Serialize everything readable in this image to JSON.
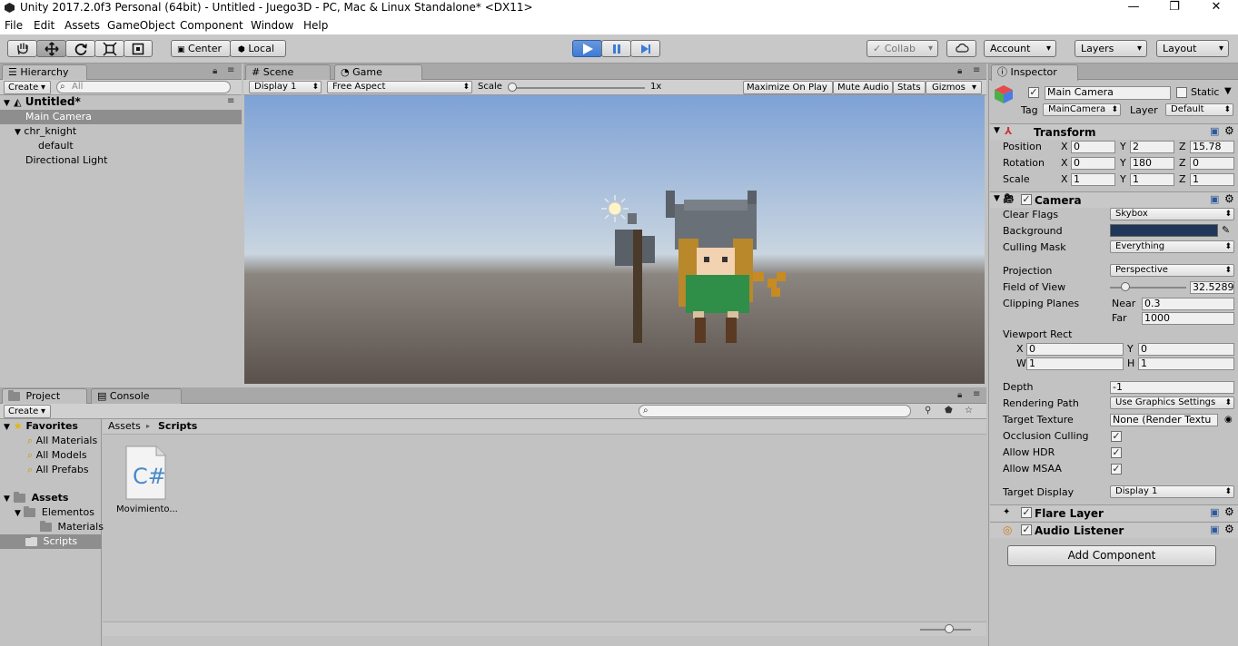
{
  "window": {
    "title": "Unity 2017.2.0f3 Personal (64bit) - Untitled - Juego3D - PC, Mac & Linux Standalone* <DX11>",
    "minimize": "—",
    "maximize": "❐",
    "close": "✕"
  },
  "menu": [
    "File",
    "Edit",
    "Assets",
    "GameObject",
    "Component",
    "Window",
    "Help"
  ],
  "toolbar": {
    "pivot": "Center",
    "space": "Local",
    "collab": "Collab",
    "account": "Account",
    "layers": "Layers",
    "layout": "Layout",
    "transform_tools": [
      "hand-icon",
      "move-icon",
      "rotate-icon",
      "scale-icon",
      "rect-icon"
    ],
    "play_controls": [
      "play-icon",
      "pause-icon",
      "step-icon"
    ],
    "play_color": "#3d7bd6"
  },
  "hierarchy": {
    "tab": "Hierarchy",
    "create": "Create",
    "search_placeholder": "All",
    "scene": "Untitled*",
    "items": [
      {
        "label": "Main Camera",
        "selected": true
      },
      {
        "label": "chr_knight"
      },
      {
        "label": "default"
      },
      {
        "label": "Directional Light"
      }
    ]
  },
  "scene_tabs": {
    "scene": "Scene",
    "game": "Game"
  },
  "game": {
    "display": "Display 1",
    "aspect": "Free Aspect",
    "scale_label": "Scale",
    "scale_value": "1x",
    "maximize": "Maximize On Play",
    "mute": "Mute Audio",
    "stats": "Stats",
    "gizmos": "Gizmos"
  },
  "project": {
    "tab_project": "Project",
    "tab_console": "Console",
    "create": "Create",
    "favorites": "Favorites",
    "favorite_items": [
      "All Materials",
      "All Models",
      "All Prefabs"
    ],
    "assets": "Assets",
    "folders": [
      {
        "label": "Elementos"
      },
      {
        "label": "Materials"
      },
      {
        "label": "Scripts",
        "selected": true
      }
    ],
    "breadcrumb": [
      "Assets",
      "Scripts"
    ],
    "files": [
      {
        "label": "Movimiento...",
        "icon": "csharp-script-icon"
      }
    ]
  },
  "inspector": {
    "tab": "Inspector",
    "name": "Main Camera",
    "static": "Static",
    "tag_label": "Tag",
    "tag": "MainCamera",
    "layer_label": "Layer",
    "layer": "Default",
    "transform": {
      "title": "Transform",
      "position": {
        "label": "Position",
        "x": "0",
        "y": "2",
        "z": "15.78"
      },
      "rotation": {
        "label": "Rotation",
        "x": "0",
        "y": "180",
        "z": "0"
      },
      "scale": {
        "label": "Scale",
        "x": "1",
        "y": "1",
        "z": "1"
      }
    },
    "camera": {
      "title": "Camera",
      "clear_flags": {
        "label": "Clear Flags",
        "value": "Skybox"
      },
      "background": {
        "label": "Background",
        "color": "#1f3658"
      },
      "culling_mask": {
        "label": "Culling Mask",
        "value": "Everything"
      },
      "projection": {
        "label": "Projection",
        "value": "Perspective"
      },
      "fov": {
        "label": "Field of View",
        "value": "32.5289"
      },
      "clipping": {
        "label": "Clipping Planes",
        "near_label": "Near",
        "near": "0.3",
        "far_label": "Far",
        "far": "1000"
      },
      "viewport": {
        "label": "Viewport Rect",
        "x": "0",
        "y": "0",
        "w": "1",
        "h": "1"
      },
      "depth": {
        "label": "Depth",
        "value": "-1"
      },
      "rendering_path": {
        "label": "Rendering Path",
        "value": "Use Graphics Settings"
      },
      "target_texture": {
        "label": "Target Texture",
        "value": "None (Render Textu"
      },
      "occlusion": {
        "label": "Occlusion Culling"
      },
      "hdr": {
        "label": "Allow HDR"
      },
      "msaa": {
        "label": "Allow MSAA"
      },
      "target_display": {
        "label": "Target Display",
        "value": "Display 1"
      }
    },
    "flare": "Flare Layer",
    "audio": "Audio Listener",
    "add_component": "Add Component",
    "axis": {
      "x": "X",
      "y": "Y",
      "z": "Z",
      "w": "W",
      "h": "H"
    }
  }
}
